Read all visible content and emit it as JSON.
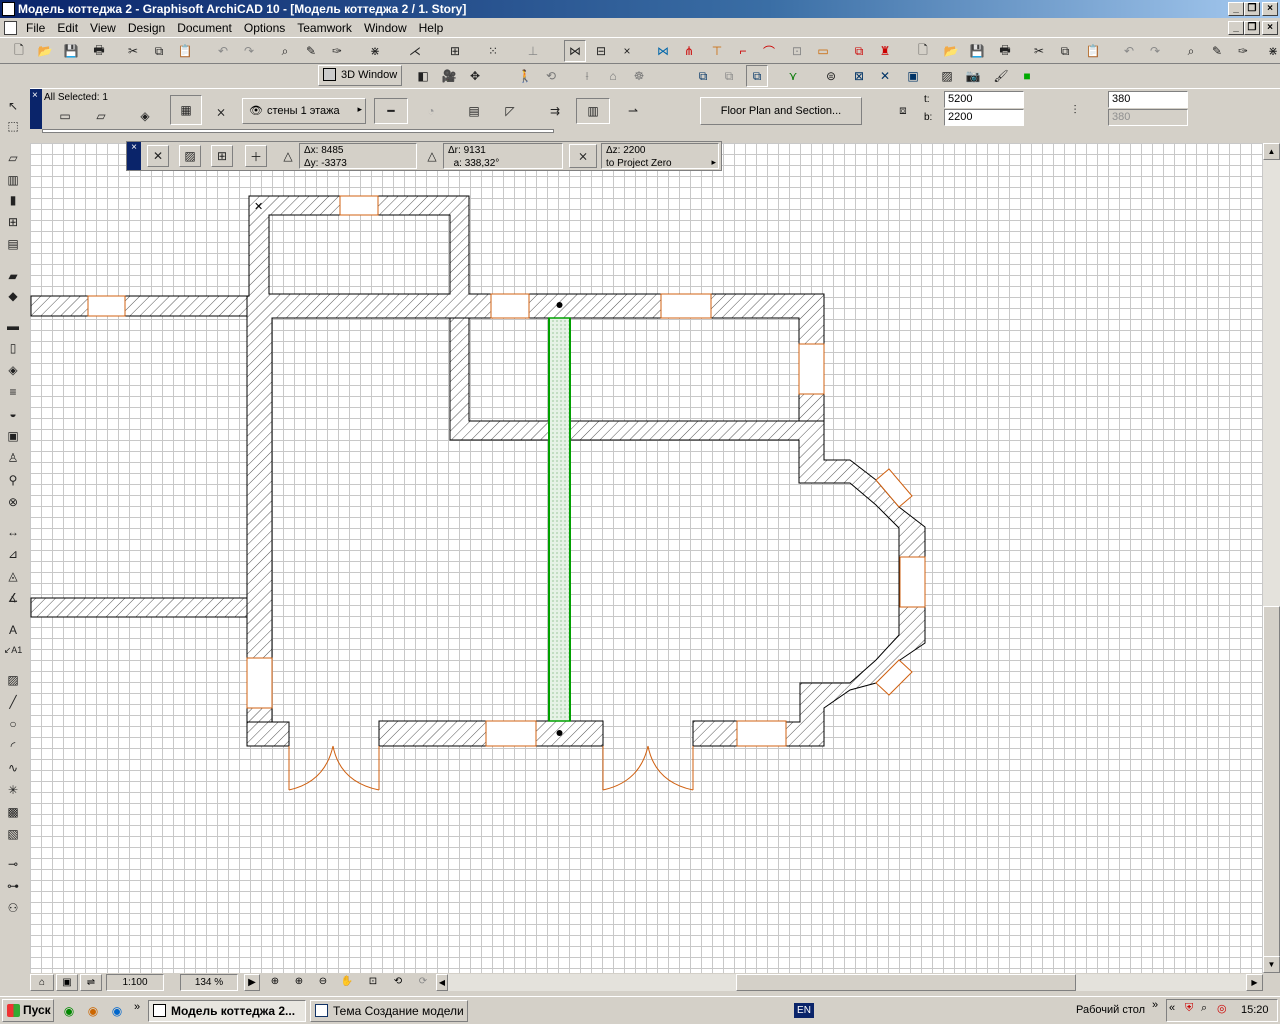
{
  "window": {
    "title": "Модель коттеджа 2 - Graphisoft ArchiCAD 10 - [Модель коттеджа 2 / 1. Story]",
    "title_icon": "archicad-doc-icon"
  },
  "menu": [
    "File",
    "Edit",
    "View",
    "Design",
    "Document",
    "Options",
    "Teamwork",
    "Window",
    "Help"
  ],
  "toolbar2": {
    "window_3d_label": "3D Window"
  },
  "infobox": {
    "selection_label": "All Selected: 1",
    "layer_label": "стены 1 этажа",
    "floor_plan_button": "Floor Plan and Section...",
    "height_top_label": "t:",
    "height_top": "5200",
    "height_bottom_label": "b:",
    "height_bottom": "2200",
    "thickness": "380",
    "thickness_disabled": "380"
  },
  "coords": {
    "dx_label": "Δx:",
    "dx": "8485",
    "dy_label": "Δy:",
    "dy": "-3373",
    "dr_label": "Δr:",
    "dr": "9131",
    "a_label": "a:",
    "a": "338,32°",
    "dz_label": "Δz:",
    "dz": "2200",
    "ref_label": "to Project Zero"
  },
  "statusbar": {
    "scale": "1:100",
    "zoom": "134 %"
  },
  "colors": {
    "selected_wall": "#00a000",
    "openings": "#d06010",
    "grid": "#c8c8c8",
    "title_bar": "#0a246a"
  },
  "taskbar": {
    "start": "Пуск",
    "tasks": [
      "Модель коттеджа 2...",
      "Тема Создание модели ..."
    ],
    "lang": "EN",
    "desktop": "Рабочий стол",
    "clock": "15:20"
  }
}
